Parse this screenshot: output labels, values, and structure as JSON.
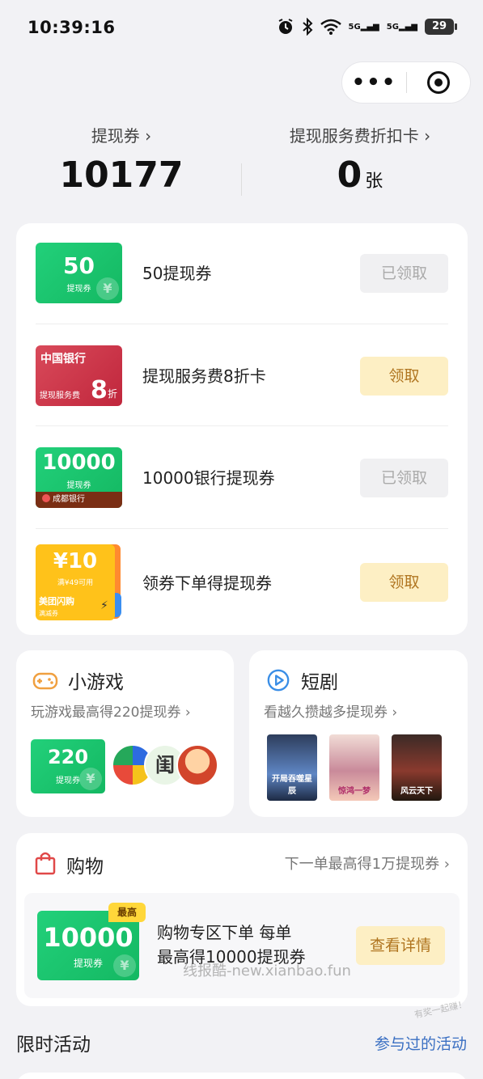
{
  "status_bar": {
    "time": "10:39:16",
    "network_1": "5G",
    "network_2": "5G",
    "battery": "29"
  },
  "summary": {
    "coupon_label": "提现券",
    "coupon_value": "10177",
    "discount_card_label": "提现服务费折扣卡",
    "discount_card_value": "0",
    "discount_card_unit": "张"
  },
  "rewards": [
    {
      "name": "50提现券",
      "button": "已领取",
      "thumb_big": "50",
      "thumb_small": "提现券"
    },
    {
      "name": "提现服务费8折卡",
      "button": "领取",
      "thumb_bank": "中国银行",
      "thumb_svc": "提现服务费",
      "thumb_discount": "8",
      "thumb_unit": "折"
    },
    {
      "name": "10000银行提现券",
      "button": "已领取",
      "thumb_big": "10000",
      "thumb_small": "提现券",
      "thumb_bank": "成都银行"
    },
    {
      "name": "领券下单得提现券",
      "button": "领取",
      "thumb_amount": "¥10",
      "thumb_cond": "满¥49可用",
      "thumb_brand": "美团闪购",
      "thumb_kind": "满减券"
    }
  ],
  "games": {
    "title": "小游戏",
    "subtitle": "玩游戏最高得220提现券",
    "coupon_big": "220",
    "coupon_small": "提现券",
    "avatar_text": "闺"
  },
  "dramas": {
    "title": "短剧",
    "subtitle": "看越久攒越多提现券",
    "poster_1": "开局吞噬星辰",
    "poster_2": "惊鸿一梦",
    "poster_3": "风云天下"
  },
  "shopping": {
    "title": "购物",
    "more": "下一单最高得1万提现券",
    "badge": "最高",
    "coupon_big": "10000",
    "coupon_small": "提现券",
    "desc_line1": "购物专区下单 每单",
    "desc_line2": "最高得10000提现券",
    "button": "查看详情"
  },
  "watermark": "线报酷-new.xianbao.fun",
  "stamp": "有奖一起赚！",
  "limited": {
    "title": "限时活动",
    "link": "参与过的活动"
  },
  "colors": {
    "green": "#14b862",
    "claim_bg": "#fdefc4",
    "claim_text": "#b07520",
    "link": "#3a6fc2"
  }
}
